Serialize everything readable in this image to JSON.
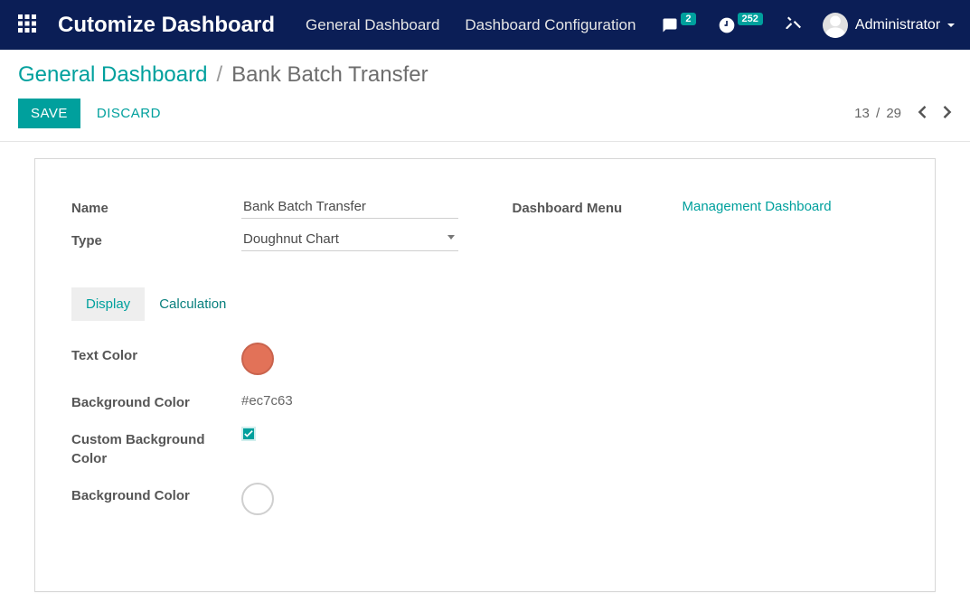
{
  "navbar": {
    "brand": "Cutomize Dashboard",
    "links": [
      {
        "label": "General Dashboard"
      },
      {
        "label": "Dashboard Configuration"
      }
    ],
    "badges": {
      "messages": "2",
      "activities": "252"
    },
    "user": "Administrator"
  },
  "breadcrumb": {
    "parent": "General Dashboard",
    "current": "Bank Batch Transfer"
  },
  "buttons": {
    "save": "SAVE",
    "discard": "DISCARD"
  },
  "pager": {
    "pos": "13",
    "sep": "/",
    "total": "29"
  },
  "form": {
    "name": {
      "label": "Name",
      "value": "Bank Batch Transfer"
    },
    "type": {
      "label": "Type",
      "value": "Doughnut Chart"
    },
    "dashboard_menu": {
      "label": "Dashboard Menu",
      "value": "Management Dashboard"
    },
    "tabs": {
      "display": "Display",
      "calculation": "Calculation"
    },
    "text_color": {
      "label": "Text Color",
      "value": "#e27258"
    },
    "bg_color_text": {
      "label": "Background Color",
      "value": "#ec7c63"
    },
    "custom_bg": {
      "label": "Custom Background Color",
      "checked": true
    },
    "bg_color_swatch": {
      "label": "Background Color",
      "value": "#ffffff"
    }
  }
}
